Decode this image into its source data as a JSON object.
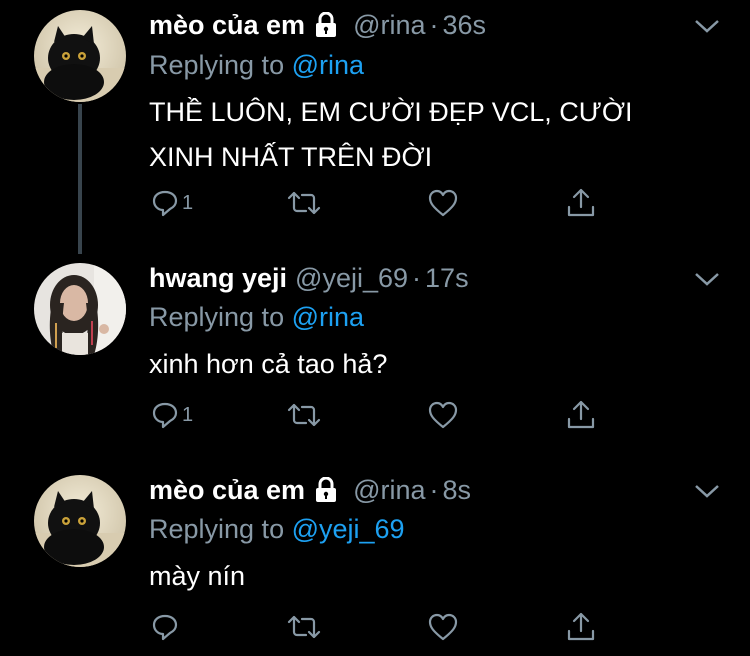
{
  "tweets": [
    {
      "name": "mèo của em",
      "locked": true,
      "handle": "@rina",
      "sep": "·",
      "time": "36s",
      "replying_prefix": "Replying to ",
      "replying_to": "@rina",
      "text_lines": [
        "THỀ LUÔN, EM CƯỜI ĐẸP VCL, CƯỜI",
        "XINH NHẤT TRÊN ĐỜI"
      ],
      "reply_count": "1",
      "avatar": "black-cat-avatar"
    },
    {
      "name": "hwang yeji",
      "locked": false,
      "handle": "@yeji_69",
      "sep": "·",
      "time": "17s",
      "replying_prefix": "Replying to ",
      "replying_to": "@rina",
      "text_lines": [
        "xinh hơn cả tao hả?"
      ],
      "reply_count": "1",
      "avatar": "girl-portrait-avatar"
    },
    {
      "name": "mèo của em",
      "locked": true,
      "handle": "@rina",
      "sep": "·",
      "time": "8s",
      "replying_prefix": "Replying to ",
      "replying_to": "@yeji_69",
      "text_lines": [
        "mày nín"
      ],
      "reply_count": "",
      "avatar": "black-cat-avatar"
    }
  ],
  "colors": {
    "background": "#000000",
    "text": "#ffffff",
    "muted": "#8899a6",
    "mention": "#1da1f2",
    "thread_line": "#38444d"
  },
  "icons": [
    "lock-icon",
    "chevron-down-icon",
    "reply-icon",
    "retweet-icon",
    "like-icon",
    "share-icon"
  ]
}
